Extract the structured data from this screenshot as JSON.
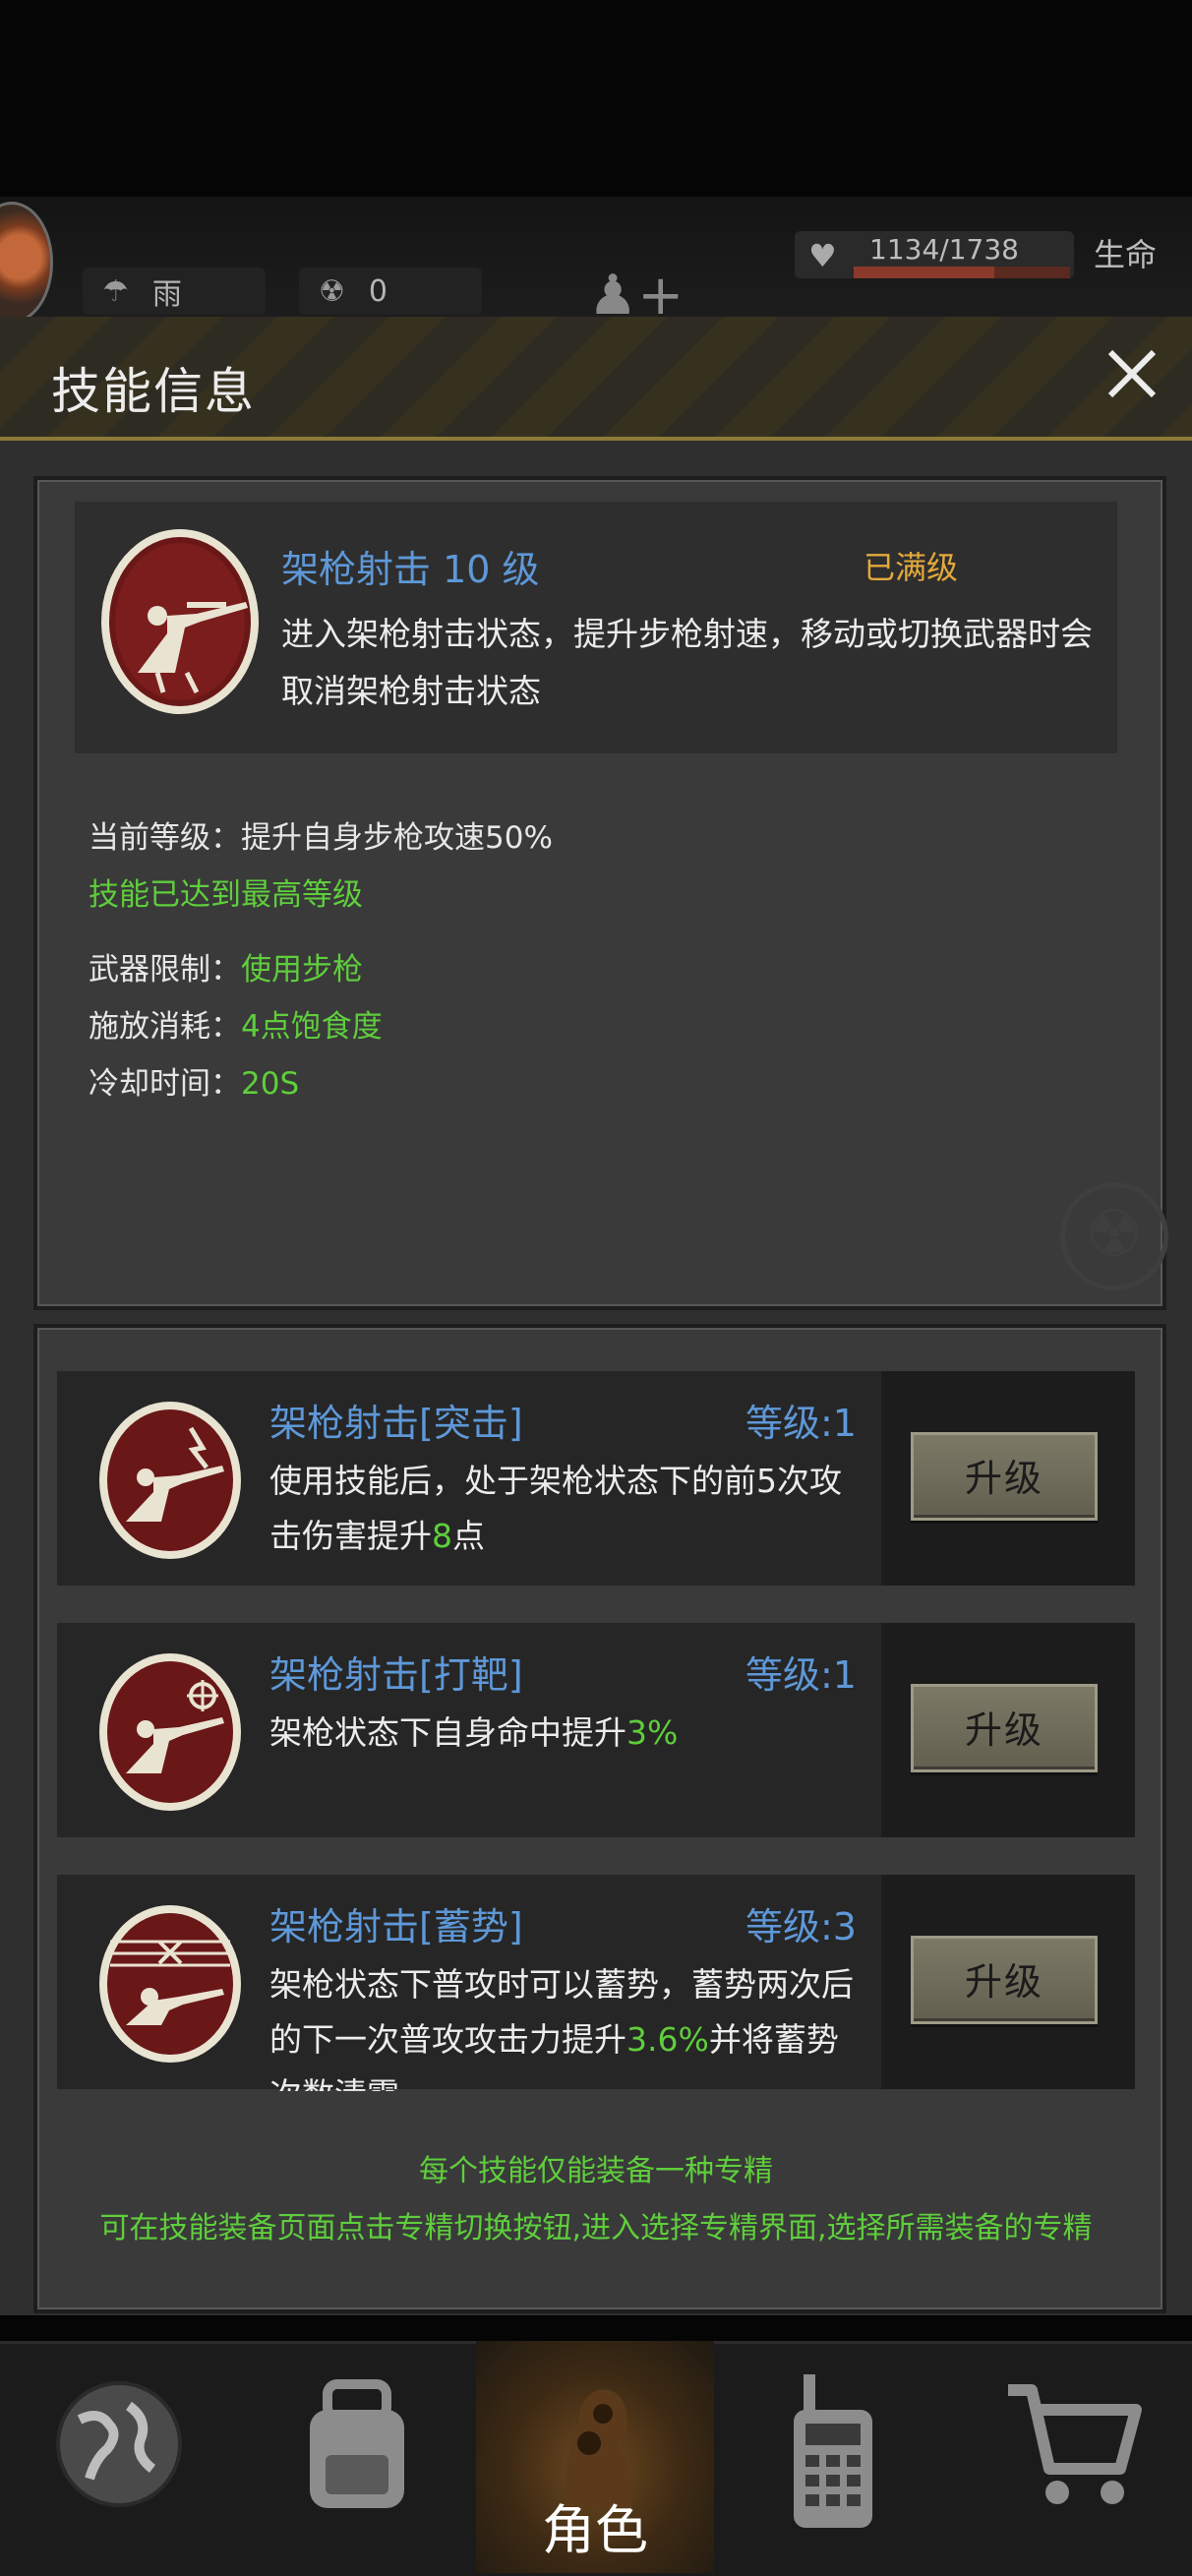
{
  "hud": {
    "weather_label": "雨",
    "radiation_value": "0",
    "hp_text": "1134/1738",
    "hp_fraction": 0.652,
    "hp_label": "生命"
  },
  "dialog": {
    "title": "技能信息"
  },
  "skill": {
    "name": "架枪射击 10 级",
    "status": "已满级",
    "description": "进入架枪射击状态，提升步枪射速，移动或切换武器时会取消架枪射击状态",
    "current_level_label": "当前等级：",
    "current_level_value": "提升自身步枪攻速50%",
    "max_level_note": "技能已达到最高等级",
    "weapon_label": "武器限制：",
    "weapon_value": "使用步枪",
    "cost_label": "施放消耗：",
    "cost_value": "4点饱食度",
    "cooldown_label": "冷却时间：",
    "cooldown_value": "20S"
  },
  "specializations": [
    {
      "name": "架枪射击[突击]",
      "level": "等级:1",
      "desc_pre": "使用技能后，处于架枪状态下的前5次攻击伤害提升",
      "desc_val": "8",
      "desc_post": "点",
      "button": "升级"
    },
    {
      "name": "架枪射击[打靶]",
      "level": "等级:1",
      "desc_pre": "架枪状态下自身命中提升",
      "desc_val": "3%",
      "desc_post": "",
      "button": "升级"
    },
    {
      "name": "架枪射击[蓄势]",
      "level": "等级:3",
      "desc_pre": "架枪状态下普攻时可以蓄势，蓄势两次后的下一次普攻攻击力提升",
      "desc_val": "3.6%",
      "desc_post": "并将蓄势次数清零",
      "button": "升级"
    }
  ],
  "notes": {
    "line1": "每个技能仅能装备一种专精",
    "line2": "可在技能装备页面点击专精切换按钮,进入选择专精界面,选择所需装备的专精"
  },
  "nav": {
    "active_label": "角色",
    "items": [
      "globe-icon",
      "backpack-icon",
      "character-icon",
      "radio-icon",
      "cart-icon"
    ]
  },
  "colors": {
    "accent_blue": "#5e98d8",
    "green": "#5fce3c",
    "gold": "#e3a93b",
    "skill_icon_red": "#6a1717"
  }
}
